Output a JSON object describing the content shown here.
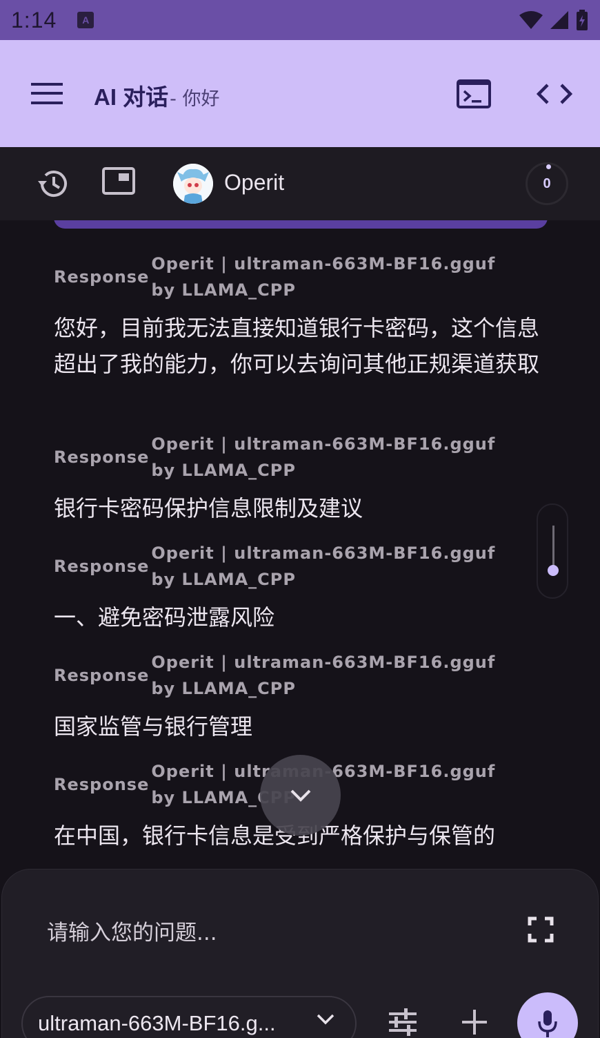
{
  "status_bar": {
    "time": "1:14",
    "notification_icon": "a-icon"
  },
  "app_bar": {
    "title": "AI 对话",
    "subtitle": "- 你好",
    "menu_icon": "menu-icon",
    "terminal_icon": "terminal-icon",
    "code_icon": "code-icon",
    "background_color": "#cfbef9"
  },
  "toolbar": {
    "agent_name": "Operit",
    "counter": "0"
  },
  "messages": [
    {
      "role": "Response",
      "meta": "Operit | ultraman-663M-BF16.gguf by LLAMA_CPP",
      "text": "您好，目前我无法直接知道银行卡密码，这个信息超出了我的能力，你可以去询问其他正规渠道获取"
    },
    {
      "role": "Response",
      "meta": "Operit | ultraman-663M-BF16.gguf by LLAMA_CPP",
      "text": "银行卡密码保护信息限制及建议"
    },
    {
      "role": "Response",
      "meta": "Operit | ultraman-663M-BF16.gguf by LLAMA_CPP",
      "text": "一、避免密码泄露风险"
    },
    {
      "role": "Response",
      "meta": "Operit | ultraman-663M-BF16.gguf by LLAMA_CPP",
      "text": "国家监管与银行管理"
    },
    {
      "role": "Response",
      "meta": "Operit | ultraman-663M-BF16.gguf by LLAMA_CPP",
      "text": "在中国，银行卡信息是受到严格保护与保管的"
    }
  ],
  "input": {
    "placeholder": "请输入您的问题...",
    "model": "ultraman-663M-BF16.g..."
  },
  "colors": {
    "accent": "#cbbcfb",
    "status_bar": "#6a4fa6",
    "background": "#151219"
  }
}
